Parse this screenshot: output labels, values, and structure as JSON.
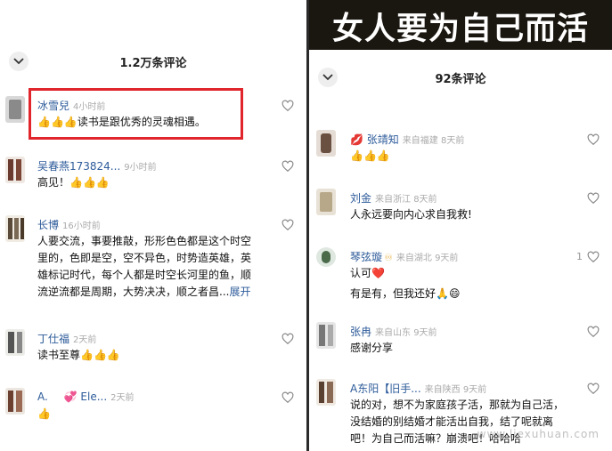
{
  "left": {
    "count_title": "1.2万条评论",
    "comments": [
      {
        "name": "冰雪兒",
        "meta": "4小时前",
        "text": "👍👍👍读书是跟优秀的灵魂相遇。"
      },
      {
        "name": "吴春燕173824...",
        "meta": "9小时前",
        "text": "高见！👍👍👍"
      },
      {
        "name": "长博",
        "meta": "16小时前",
        "lines": [
          "人要交流，事要推敲，形形色色都是这个时空",
          "里的，色即是空，空不异色，时势造英雄，英",
          "雄标记时代，每个人都是时空长河里的鱼，顺",
          "流逆流都是周期，大势决决，顺之者昌..."
        ],
        "more": "展开"
      },
      {
        "name": "丁仕福",
        "meta": "2天前",
        "text": "读书至尊👍👍👍"
      },
      {
        "name": "A.",
        "name2": "Ele...",
        "meta": "2天前",
        "text": "👍"
      }
    ]
  },
  "right": {
    "banner": "女人要为自己而活",
    "count_title": "92条评论",
    "comments": [
      {
        "name": "张靖知",
        "meta": "来自福建 8天前",
        "text": "👍👍👍"
      },
      {
        "name": "刘金",
        "meta": "来自浙江 8天前",
        "text": "人永远要向内心求自我救!"
      },
      {
        "name": "琴弦璇",
        "meta": "来自湖北 9天前",
        "text": "认可❤️",
        "text2": "有是有，但我还好🙏😄",
        "likes": "1"
      },
      {
        "name": "张冉",
        "meta": "来自山东 9天前",
        "text": "感谢分享"
      },
      {
        "name": "A东阳【旧手...",
        "meta": "来自陕西 9天前",
        "lines": [
          "说的对，想不为家庭孩子活，那就为自己活，",
          "没结婚的别结婚才能活出自我，结了呢就离",
          "吧！为自己而活嘛？崩溃吧！哈哈哈"
        ]
      }
    ]
  },
  "watermark": "www.liexuhuan.com",
  "colors": {
    "accent_red": "#e0252c",
    "link_blue": "#2d5b9a",
    "banner_bg": "#1a1610"
  }
}
